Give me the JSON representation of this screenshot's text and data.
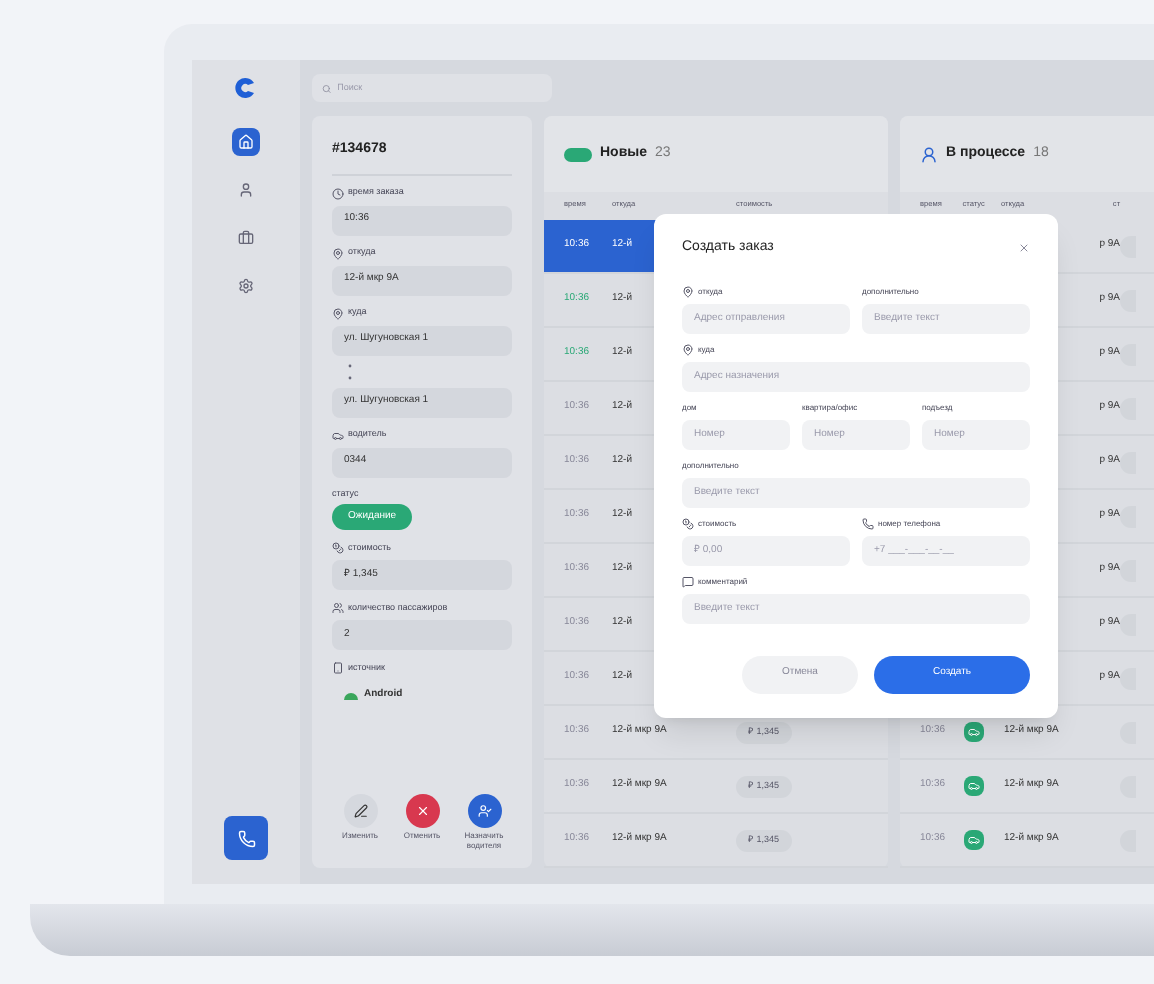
{
  "sidebar": {
    "items": [
      {
        "kind": "home",
        "selected": true
      },
      {
        "kind": "user",
        "selected": false
      },
      {
        "kind": "briefcase",
        "selected": false
      },
      {
        "kind": "settings",
        "selected": false
      }
    ]
  },
  "search": {
    "placeholder": "Поиск"
  },
  "order": {
    "id": "#134678",
    "fields": [
      {
        "kind": "clock",
        "label": "время заказа",
        "values": [
          "10:36"
        ]
      },
      {
        "kind": "pin",
        "label": "откуда",
        "values": [
          "12-й мкр 9А"
        ]
      },
      {
        "kind": "pin",
        "label": "куда",
        "values": [
          "ул. Шугуновская 1",
          "ул. Шугуновская 1"
        ]
      },
      {
        "kind": "car",
        "label": "водитель",
        "values": [
          "0344"
        ]
      }
    ],
    "status": {
      "label": "статус",
      "badge": "Ожидание"
    },
    "extra": [
      {
        "kind": "coin",
        "label": "стоимость",
        "value": "₽ 1,345"
      },
      {
        "kind": "people",
        "label": "количество пассажиров",
        "value": "2"
      },
      {
        "kind": "source",
        "label": "источник",
        "value": "Android"
      }
    ],
    "actions": [
      {
        "kind": "edit",
        "label": "Изменить"
      },
      {
        "kind": "cancel",
        "label": "Отменить"
      },
      {
        "kind": "assign",
        "label": "Назначить водителя"
      }
    ]
  },
  "columns": [
    {
      "kind": "new",
      "title": "Новые",
      "count": "23",
      "headers": [
        "время",
        "откуда",
        "стоимость"
      ],
      "rows": [
        {
          "kind": "covered",
          "time": "10:36",
          "from": "12-й",
          "selected": true,
          "fresh": false
        },
        {
          "kind": "covered",
          "time": "10:36",
          "from": "12-й",
          "selected": false,
          "fresh": true
        },
        {
          "kind": "covered",
          "time": "10:36",
          "from": "12-й",
          "selected": false,
          "fresh": true
        },
        {
          "kind": "covered",
          "time": "10:36",
          "from": "12-й",
          "selected": false,
          "fresh": false
        },
        {
          "kind": "covered",
          "time": "10:36",
          "from": "12-й",
          "selected": false,
          "fresh": false
        },
        {
          "kind": "covered",
          "time": "10:36",
          "from": "12-й",
          "selected": false,
          "fresh": false
        },
        {
          "kind": "covered",
          "time": "10:36",
          "from": "12-й",
          "selected": false,
          "fresh": false
        },
        {
          "kind": "covered",
          "time": "10:36",
          "from": "12-й",
          "selected": false,
          "fresh": false
        },
        {
          "kind": "covered",
          "time": "10:36",
          "from": "12-й",
          "selected": false,
          "fresh": false
        },
        {
          "kind": "full",
          "time": "10:36",
          "from": "12-й мкр 9А",
          "cost": "₽ 1,345",
          "selected": false,
          "fresh": false
        },
        {
          "kind": "full",
          "time": "10:36",
          "from": "12-й мкр 9А",
          "cost": "₽ 1,345",
          "selected": false,
          "fresh": false
        },
        {
          "kind": "full",
          "time": "10:36",
          "from": "12-й мкр 9А",
          "cost": "₽ 1,345",
          "selected": false,
          "fresh": false
        }
      ]
    },
    {
      "kind": "progress",
      "title": "В процессе",
      "count": "18",
      "headers": [
        "время",
        "статус",
        "откуда",
        "ст"
      ],
      "rows": [
        {
          "kind": "covered",
          "from": "р 9А"
        },
        {
          "kind": "covered",
          "from": "р 9А"
        },
        {
          "kind": "covered",
          "from": "р 9А"
        },
        {
          "kind": "covered",
          "from": "р 9А"
        },
        {
          "kind": "covered",
          "from": "р 9А"
        },
        {
          "kind": "covered",
          "from": "р 9А"
        },
        {
          "kind": "covered",
          "from": "р 9А"
        },
        {
          "kind": "covered",
          "from": "р 9А"
        },
        {
          "kind": "covered",
          "from": "р 9А"
        },
        {
          "kind": "full",
          "time": "10:36",
          "from": "12-й мкр 9А"
        },
        {
          "kind": "full",
          "time": "10:36",
          "from": "12-й мкр 9А"
        },
        {
          "kind": "full",
          "time": "10:36",
          "from": "12-й мкр 9А"
        }
      ]
    }
  ],
  "modal": {
    "title": "Создать заказ",
    "rows": [
      [
        {
          "kind": "pin",
          "label": "откуда",
          "placeholder": "Адрес отправления"
        },
        {
          "kind": "none",
          "label": "дополнительно",
          "placeholder": "Введите текст"
        }
      ],
      [
        {
          "kind": "pin",
          "label": "куда",
          "placeholder": "Адрес назначения"
        }
      ],
      [
        {
          "kind": "none",
          "label": "дом",
          "placeholder": "Номер"
        },
        {
          "kind": "none",
          "label": "квартира/офис",
          "placeholder": "Номер"
        },
        {
          "kind": "none",
          "label": "подъезд",
          "placeholder": "Номер"
        }
      ],
      [
        {
          "kind": "none",
          "label": "дополнительно",
          "placeholder": "Введите текст"
        }
      ],
      [
        {
          "kind": "coin",
          "label": "стоимость",
          "placeholder": "₽ 0,00"
        },
        {
          "kind": "phone",
          "label": "номер телефона",
          "placeholder": "+7 ___-___-__-__"
        }
      ],
      [
        {
          "kind": "chat",
          "label": "комментарий",
          "placeholder": "Введите текст"
        }
      ]
    ],
    "buttons": [
      {
        "kind": "secondary",
        "label": "Отмена"
      },
      {
        "kind": "primary",
        "label": "Создать"
      }
    ]
  }
}
